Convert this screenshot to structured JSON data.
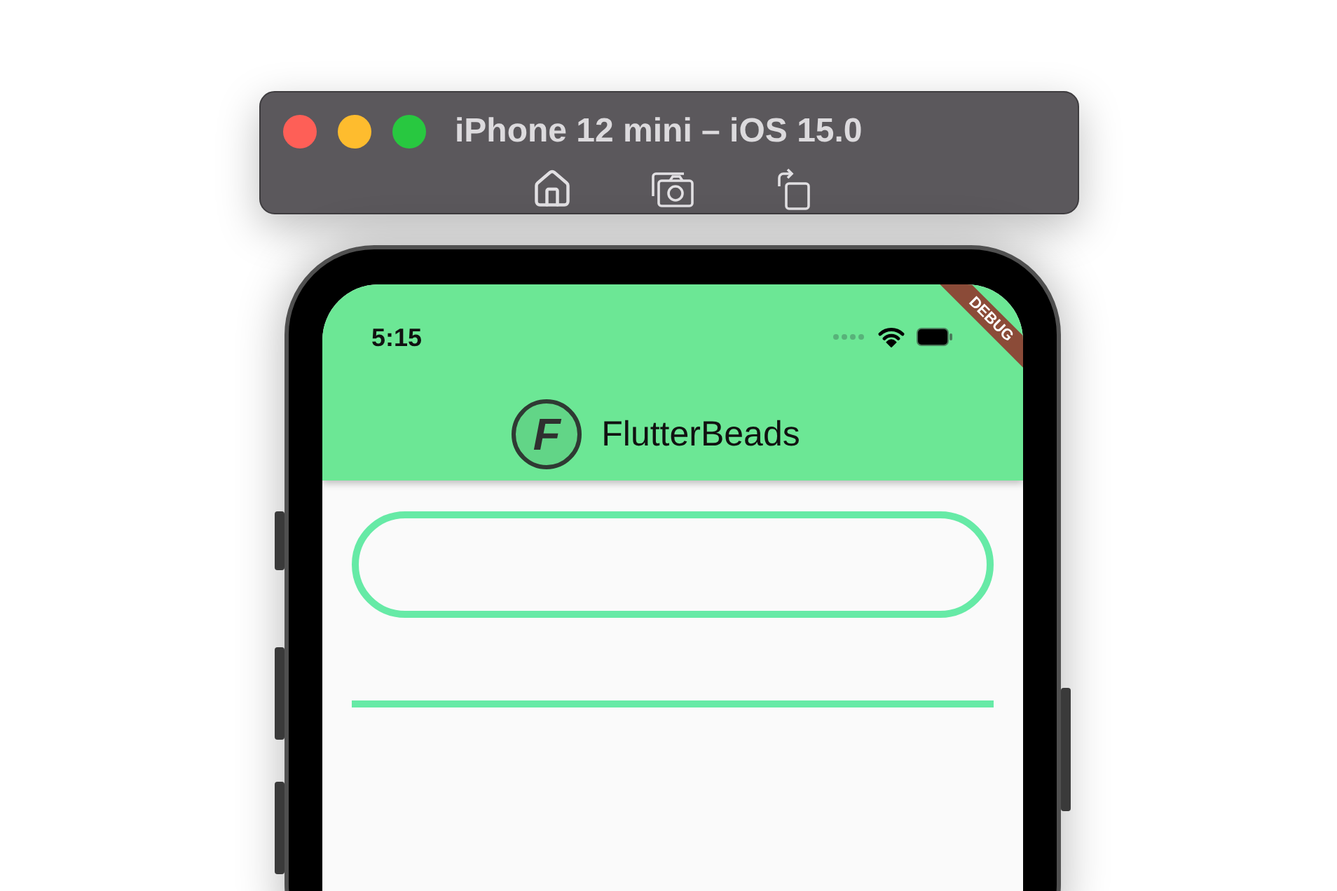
{
  "window": {
    "title": "iPhone 12 mini – iOS 15.0"
  },
  "status_bar": {
    "time": "5:15"
  },
  "debug_banner": "DEBUG",
  "app_bar": {
    "logo_letter": "F",
    "title": "FlutterBeads"
  },
  "fields": [
    {
      "kind": "rounded"
    },
    {
      "kind": "underline"
    }
  ]
}
